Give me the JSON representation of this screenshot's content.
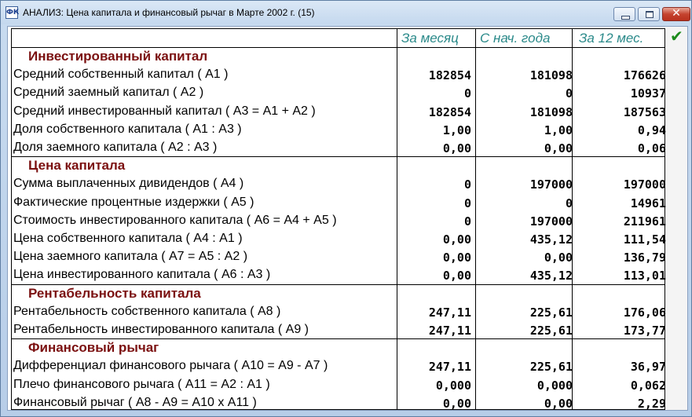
{
  "window": {
    "title": "АНАЛИЗ: Цена капитала и финансовый рычаг в Марте 2002 г. (15)",
    "icon_text": "ФК"
  },
  "columns": [
    "За месяц",
    "С нач. года",
    "За 12 мес."
  ],
  "sections": [
    {
      "title": "Инвестированный капитал",
      "rows": [
        {
          "label": "Средний собственный капитал ( А1 )",
          "values": [
            "182854",
            "181098",
            "176626"
          ]
        },
        {
          "label": "Средний заемный капитал ( А2 )",
          "values": [
            "0",
            "0",
            "10937"
          ]
        },
        {
          "label": "Средний инвестированный капитал ( А3 = А1 + А2 )",
          "values": [
            "182854",
            "181098",
            "187563"
          ]
        },
        {
          "label": "Доля собственного капитала ( А1 : А3 )",
          "values": [
            "1,00",
            "1,00",
            "0,94"
          ]
        },
        {
          "label": "Доля заемного капитала ( А2 : А3 )",
          "values": [
            "0,00",
            "0,00",
            "0,06"
          ]
        }
      ]
    },
    {
      "title": "Цена капитала",
      "rows": [
        {
          "label": "Сумма выплаченных дивидендов ( А4 )",
          "values": [
            "0",
            "197000",
            "197000"
          ]
        },
        {
          "label": "Фактические процентные издержки ( А5 )",
          "values": [
            "0",
            "0",
            "14961"
          ]
        },
        {
          "label": "Стоимость инвестированного капитала ( А6 = А4 + А5 )",
          "values": [
            "0",
            "197000",
            "211961"
          ]
        },
        {
          "label": "Цена собственного капитала ( А4 : А1 )",
          "values": [
            "0,00",
            "435,12",
            "111,54"
          ]
        },
        {
          "label": "Цена заемного капитала ( А7 = А5 : А2 )",
          "values": [
            "0,00",
            "0,00",
            "136,79"
          ]
        },
        {
          "label": "Цена инвестированного капитала ( А6 : А3 )",
          "values": [
            "0,00",
            "435,12",
            "113,01"
          ]
        }
      ]
    },
    {
      "title": "Рентабельность капитала",
      "rows": [
        {
          "label": "Рентабельность собственного капитала ( А8 )",
          "values": [
            "247,11",
            "225,61",
            "176,06"
          ]
        },
        {
          "label": "Рентабельность инвестированного капитала ( А9 )",
          "values": [
            "247,11",
            "225,61",
            "173,77"
          ]
        }
      ]
    },
    {
      "title": "Финансовый рычаг",
      "rows": [
        {
          "label": "Дифференциал финансового рычага ( А10 = А9 - А7 )",
          "values": [
            "247,11",
            "225,61",
            "36,97"
          ]
        },
        {
          "label": "Плечо финансового рычага ( А11 = А2 : А1 )",
          "values": [
            "0,000",
            "0,000",
            "0,062"
          ]
        },
        {
          "label": "Финансовый рычаг ( А8 - А9 = А10 х А11 )",
          "values": [
            "0,00",
            "0,00",
            "2,29"
          ]
        }
      ]
    }
  ],
  "confirm_icon": "checkmark-icon",
  "colors": {
    "section_title": "#7b1010",
    "column_header": "#2b8a8a",
    "confirm": "#1a8a1a"
  }
}
